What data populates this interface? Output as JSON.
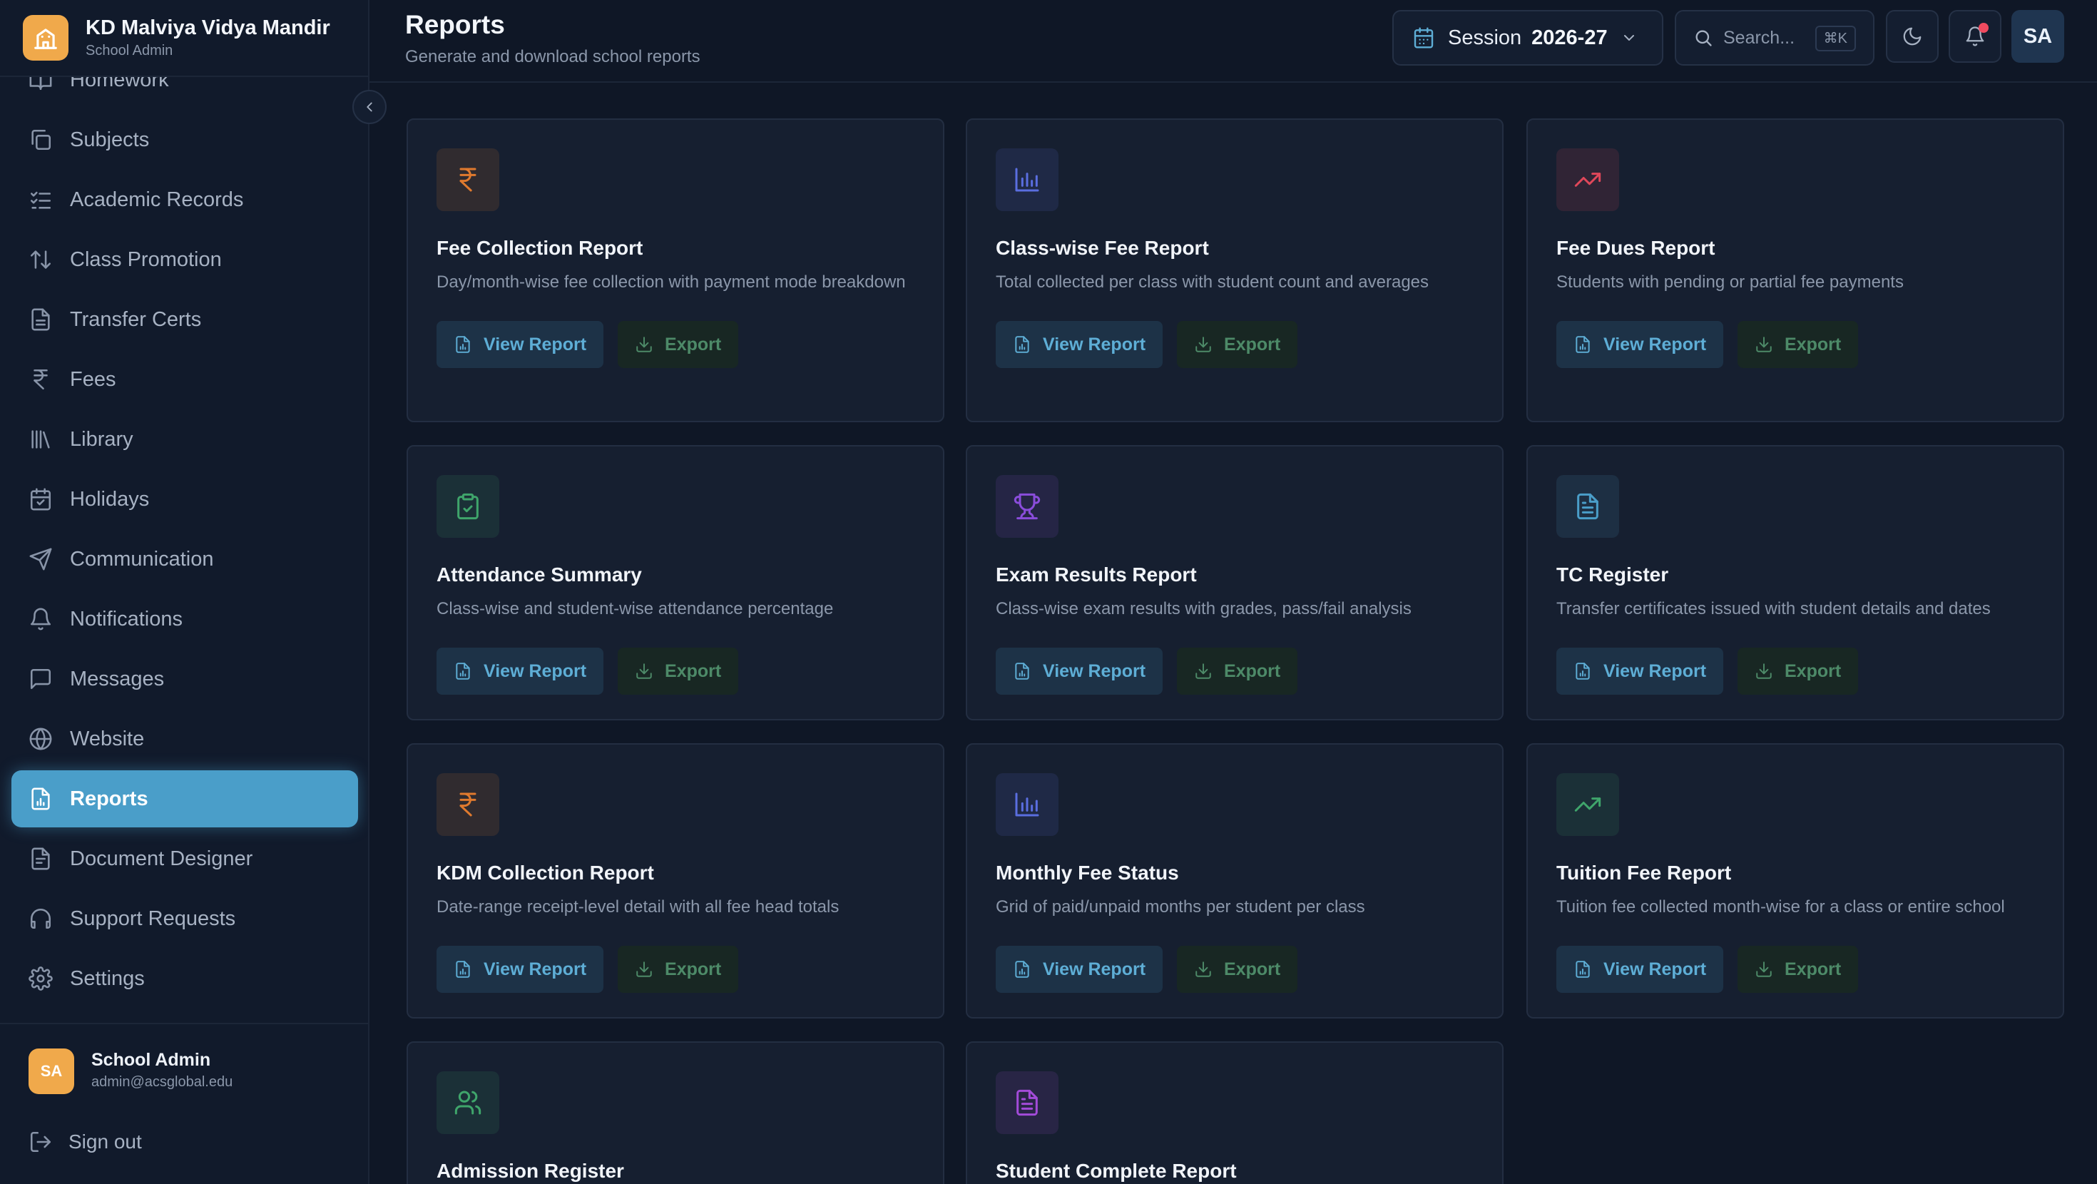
{
  "brand": {
    "name": "KD Malviya Vidya Mandir",
    "role": "School Admin"
  },
  "nav": {
    "items": [
      {
        "label": "Homework",
        "icon": "book-open-icon"
      },
      {
        "label": "Subjects",
        "icon": "copy-icon"
      },
      {
        "label": "Academic Records",
        "icon": "list-check-icon"
      },
      {
        "label": "Class Promotion",
        "icon": "arrows-up-down-icon"
      },
      {
        "label": "Transfer Certs",
        "icon": "file-text-icon"
      },
      {
        "label": "Fees",
        "icon": "rupee-icon"
      },
      {
        "label": "Library",
        "icon": "library-icon"
      },
      {
        "label": "Holidays",
        "icon": "calendar-icon"
      },
      {
        "label": "Communication",
        "icon": "send-icon"
      },
      {
        "label": "Notifications",
        "icon": "bell-icon"
      },
      {
        "label": "Messages",
        "icon": "message-square-icon"
      },
      {
        "label": "Website",
        "icon": "globe-icon"
      },
      {
        "label": "Reports",
        "icon": "file-chart-icon",
        "active": true
      },
      {
        "label": "Document Designer",
        "icon": "file-edit-icon"
      },
      {
        "label": "Support Requests",
        "icon": "headphones-icon"
      },
      {
        "label": "Settings",
        "icon": "gear-icon"
      }
    ]
  },
  "user": {
    "initials": "SA",
    "name": "School Admin",
    "email": "admin@acsglobal.edu",
    "signout": "Sign out"
  },
  "header": {
    "title": "Reports",
    "subtitle": "Generate and download school reports",
    "session_label": "Session",
    "session_value": "2026-27",
    "search_placeholder": "Search...",
    "search_shortcut": "⌘K",
    "avatar_initials": "SA"
  },
  "cards": [
    {
      "title": "Fee Collection Report",
      "description": "Day/month-wise fee collection with payment mode breakdown",
      "icon": "rupee-icon",
      "accent": "#e07a2e",
      "view": "View Report",
      "export": "Export"
    },
    {
      "title": "Class-wise Fee Report",
      "description": "Total collected per class with student count and averages",
      "icon": "bar-chart-icon",
      "accent": "#5a6ee0",
      "view": "View Report",
      "export": "Export"
    },
    {
      "title": "Fee Dues Report",
      "description": "Students with pending or partial fee payments",
      "icon": "trending-up-icon",
      "accent": "#e0475a",
      "view": "View Report",
      "export": "Export"
    },
    {
      "title": "Attendance Summary",
      "description": "Class-wise and student-wise attendance percentage",
      "icon": "clipboard-check-icon",
      "accent": "#3fa56b",
      "view": "View Report",
      "export": "Export"
    },
    {
      "title": "Exam Results Report",
      "description": "Class-wise exam results with grades, pass/fail analysis",
      "icon": "trophy-icon",
      "accent": "#8a4ddb",
      "view": "View Report",
      "export": "Export"
    },
    {
      "title": "TC Register",
      "description": "Transfer certificates issued with student details and dates",
      "icon": "file-text-icon",
      "accent": "#4a9ec9",
      "view": "View Report",
      "export": "Export"
    },
    {
      "title": "KDM Collection Report",
      "description": "Date-range receipt-level detail with all fee head totals",
      "icon": "rupee-icon",
      "accent": "#e07a2e",
      "view": "View Report",
      "export": "Export"
    },
    {
      "title": "Monthly Fee Status",
      "description": "Grid of paid/unpaid months per student per class",
      "icon": "bar-chart-icon",
      "accent": "#5a6ee0",
      "view": "View Report",
      "export": "Export"
    },
    {
      "title": "Tuition Fee Report",
      "description": "Tuition fee collected month-wise for a class or entire school",
      "icon": "trending-up-icon",
      "accent": "#3fa56b",
      "view": "View Report",
      "export": "Export"
    },
    {
      "title": "Admission Register",
      "description": "",
      "icon": "users-icon",
      "accent": "#3fa56b"
    },
    {
      "title": "Student Complete Report",
      "description": "",
      "icon": "file-text-icon",
      "accent": "#a34bd9"
    }
  ]
}
